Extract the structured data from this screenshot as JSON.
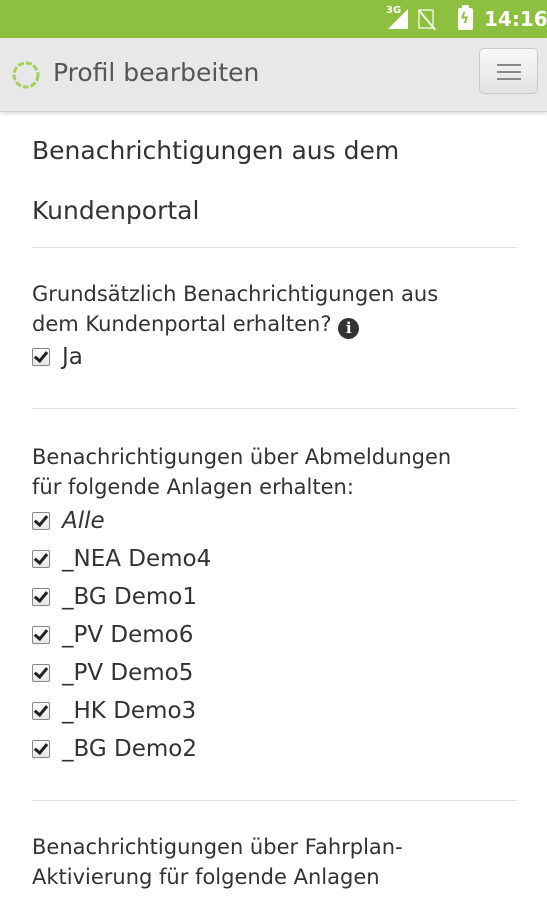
{
  "status_bar": {
    "network": "3G",
    "time": "14:16",
    "icons": [
      "signal-icon",
      "no-sim-icon",
      "battery-charging-icon"
    ]
  },
  "app_bar": {
    "title": "Profil bearbeiten",
    "logo_icon": "ring-logo-icon",
    "menu_icon": "hamburger-menu-icon"
  },
  "colors": {
    "status_bar": "#8dc03e",
    "app_bar": "#e8e8e8",
    "text": "#333333"
  },
  "section": {
    "title_line1": "Benachrichtigungen aus dem",
    "title_line2": "Kundenportal"
  },
  "general": {
    "question_line1": "Grundsätzlich Benachrichtigungen aus",
    "question_line2": "dem Kundenportal erhalten?",
    "info_icon": "info-icon",
    "option": {
      "label": "Ja",
      "checked": true
    }
  },
  "abmeldungen": {
    "question_line1": "Benachrichtigungen über Abmeldungen",
    "question_line2": "für folgende Anlagen erhalten:",
    "options": [
      {
        "label": "Alle",
        "checked": true
      },
      {
        "label": "_NEA Demo4",
        "checked": true
      },
      {
        "label": "_BG Demo1",
        "checked": true
      },
      {
        "label": "_PV Demo6",
        "checked": true
      },
      {
        "label": "_PV Demo5",
        "checked": true
      },
      {
        "label": "_HK Demo3",
        "checked": true
      },
      {
        "label": "_BG Demo2",
        "checked": true
      }
    ]
  },
  "fahrplan": {
    "question_line1": "Benachrichtigungen über Fahrplan-",
    "question_line2": "Aktivierung für folgende Anlagen"
  }
}
